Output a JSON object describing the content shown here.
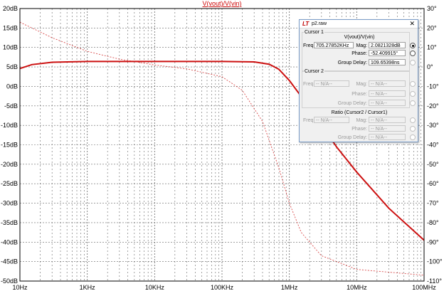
{
  "plot": {
    "title": "V(vout)/V(vin)",
    "left_ticks": [
      "20dB",
      "15dB",
      "10dB",
      "5dB",
      "0dB",
      "-5dB",
      "-10dB",
      "-15dB",
      "-20dB",
      "-25dB",
      "-30dB",
      "-35dB",
      "-40dB",
      "-45dB",
      "-50dB"
    ],
    "right_ticks": [
      "30°",
      "20°",
      "10°",
      "0°",
      "-10°",
      "-20°",
      "-30°",
      "-40°",
      "-50°",
      "-60°",
      "-70°",
      "-80°",
      "-90°",
      "-100°",
      "-110°"
    ],
    "x_ticks": [
      "10Hz",
      "1KHz",
      "10KHz",
      "100KHz",
      "1MHz",
      "10MHz",
      "100MHz"
    ],
    "colors": {
      "trace": "#cc1010",
      "grid": "#666666",
      "frame": "#000000"
    }
  },
  "chart_data": {
    "type": "line",
    "x_scale": "log",
    "x_unit": "Hz",
    "xlim": [
      100,
      100000000
    ],
    "ylim_left": [
      -50,
      20
    ],
    "ylim_right": [
      -110,
      30
    ],
    "y_left_unit": "dB",
    "y_right_unit": "°",
    "series": [
      {
        "name": "magnitude",
        "axis": "left",
        "style": "solid",
        "x": [
          100,
          150,
          300,
          1000,
          10000,
          100000,
          300000,
          500000,
          700000,
          1000000,
          2000000,
          5000000,
          10000000,
          30000000,
          100000000
        ],
        "y": [
          4.6,
          5.6,
          6.2,
          6.4,
          6.4,
          6.4,
          6.3,
          5.7,
          4.4,
          1.5,
          -5.5,
          -15.5,
          -22,
          -31.3,
          -39.5
        ]
      },
      {
        "name": "phase",
        "axis": "right",
        "style": "dashed",
        "x": [
          100,
          300,
          1000,
          3000,
          10000,
          30000,
          100000,
          200000,
          400000,
          700000,
          1000000,
          1500000,
          3000000,
          10000000,
          100000000
        ],
        "y": [
          23,
          15,
          8,
          4,
          1,
          -1,
          -5,
          -12,
          -28,
          -52,
          -70,
          -85,
          -97,
          -104,
          -107
        ]
      }
    ]
  },
  "cursor_window": {
    "title": "p2.raw",
    "app_icon": "LT",
    "close": "✕",
    "cursor1": {
      "section": "Cursor 1",
      "expr": "V(vout)/V(vin)",
      "freq_label": "Freq:",
      "freq": "705.27852KHz",
      "mag_label": "Mag:",
      "mag": "2.0821328dB",
      "phase_label": "Phase:",
      "phase": "-52.409915°",
      "gd_label": "Group Delay:",
      "gd": "109.65398ns"
    },
    "cursor2": {
      "section": "Cursor 2",
      "freq_label": "Freq:",
      "freq": "-- N/A--",
      "mag_label": "Mag:",
      "mag": "-- N/A--",
      "phase_label": "Phase:",
      "phase": "-- N/A--",
      "gd_label": "Group Delay:",
      "gd": "-- N/A--"
    },
    "ratio": {
      "section": "Ratio (Cursor2 / Cursor1)",
      "freq_label": "Freq:",
      "freq": "-- N/A--",
      "mag_label": "Mag:",
      "mag": "-- N/A--",
      "phase_label": "Phase:",
      "phase": "-- N/A--",
      "gd_label": "Group Delay:",
      "gd": "-- N/A--"
    }
  }
}
